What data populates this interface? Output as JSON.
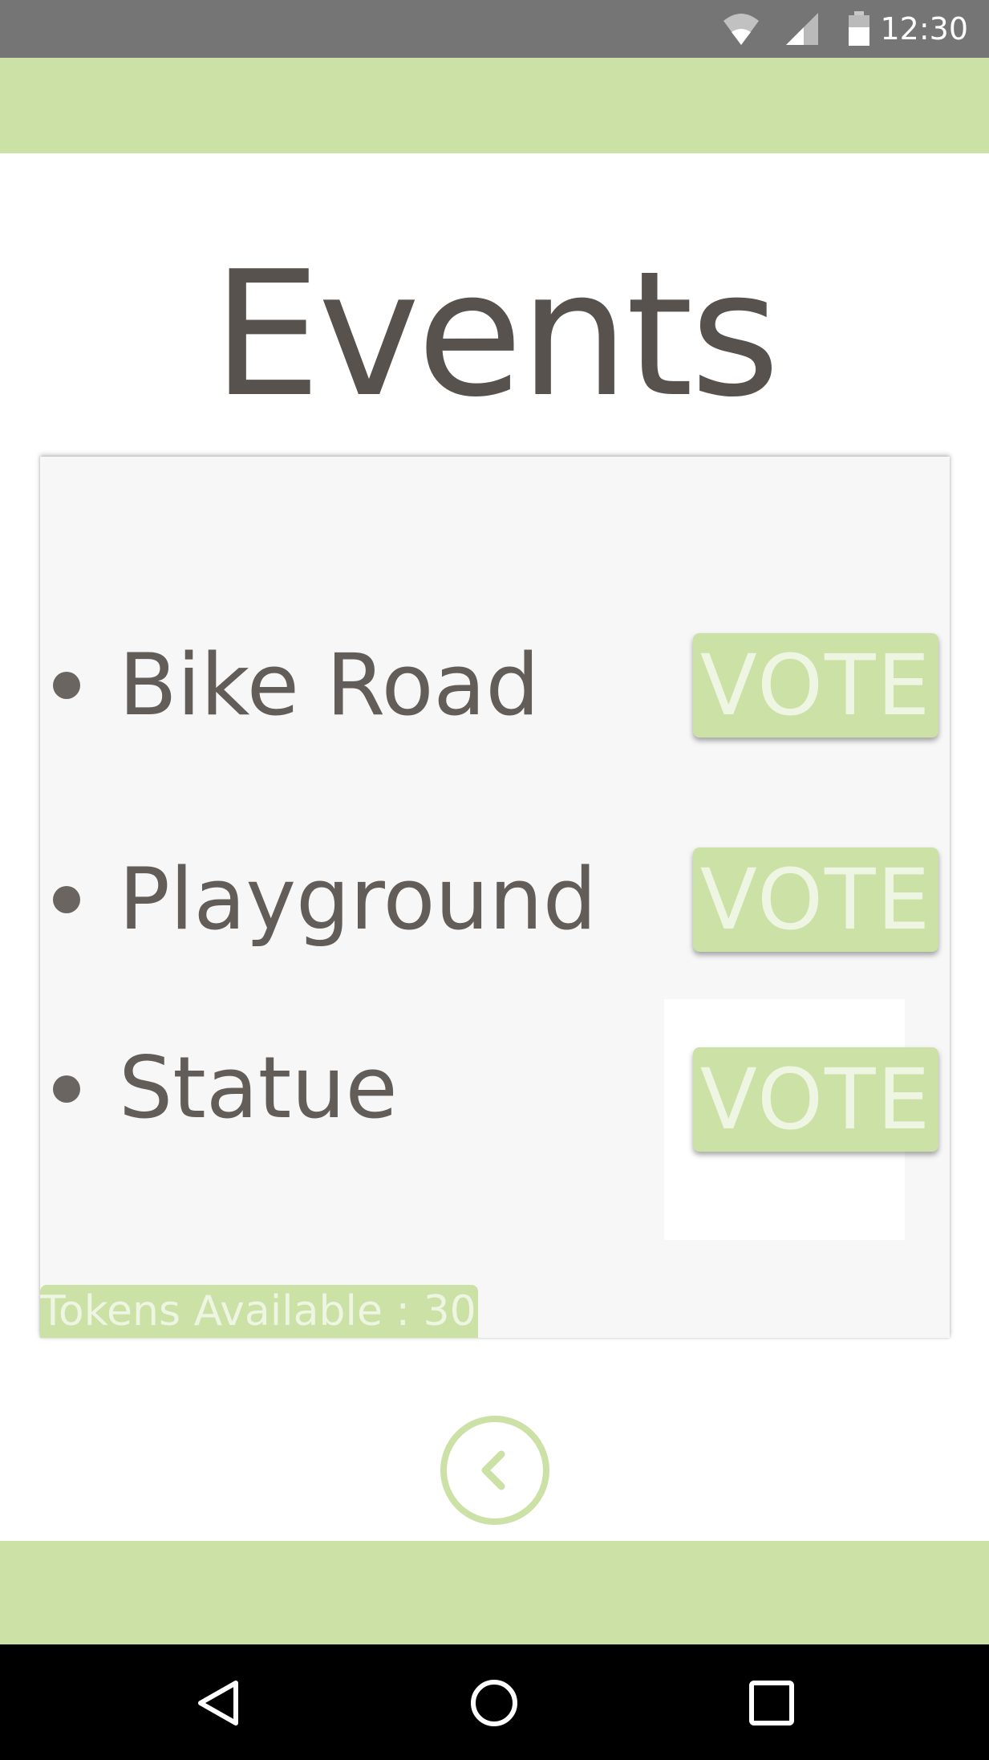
{
  "status_bar": {
    "time": "12:30",
    "icons": [
      "wifi-icon",
      "cell-signal-icon",
      "battery-icon"
    ]
  },
  "header": {
    "title": "Events"
  },
  "events": [
    {
      "name": "Bike Road",
      "vote_label": "VOTE"
    },
    {
      "name": "Playground",
      "vote_label": "VOTE"
    },
    {
      "name": "Statue",
      "vote_label": "VOTE"
    }
  ],
  "tokens": {
    "label": "Tokens Available : 30"
  },
  "back_button": {
    "icon": "chevron-left-icon"
  },
  "nav_bar": {
    "icons": [
      "back-triangle-icon",
      "home-circle-icon",
      "recents-square-icon"
    ]
  },
  "colors": {
    "accent": "#cbe1a5",
    "text": "#625d58",
    "status_bar": "#757575",
    "panel": "#f7f7f7"
  }
}
